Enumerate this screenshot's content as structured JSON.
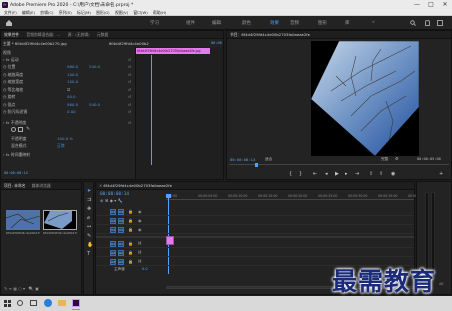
{
  "window": {
    "title": "Adobe Premiere Pro 2020 - C:\\用户\\文档\\未命名.prproj *",
    "menu": [
      "文件(F)",
      "编辑(E)",
      "剪辑(C)",
      "序列(S)",
      "标记(M)",
      "图形(G)",
      "视图(V)",
      "窗口(W)",
      "帮助(H)"
    ],
    "minimize": "—",
    "maximize": "□",
    "close": "✕"
  },
  "workspaces": [
    "学习",
    "组件",
    "编辑",
    "颜色",
    "效果",
    "音频",
    "图形",
    "库"
  ],
  "workspace_active": "效果",
  "effect_controls": {
    "tabs": [
      "效果控件",
      "音频剪辑混合器：...",
      "源：(无剪辑)",
      "元数据"
    ],
    "source_label": "主要 * 6f4d4f29fd4c4e00b270.jpg",
    "sequence_label": "6f4d4f29fd4c4e00b270 * 6f4d4f...",
    "timecode": "00:00",
    "clip_label": "6f4d4f29fd4c4e00b2703fa0aeae2fe.jpg",
    "section_video": "视频",
    "section_motion": "fx 运动",
    "rows": [
      {
        "name": "位置",
        "v1": "960.0",
        "v2": "540.0"
      },
      {
        "name": "缩放高度",
        "v1": "100.0",
        "v2": ""
      },
      {
        "name": "缩放宽度",
        "v1": "100.0",
        "v2": ""
      },
      {
        "name": "等比缩放",
        "v1": "",
        "v2": "",
        "check": true
      },
      {
        "name": "旋转",
        "v1": "40.0",
        "v2": ""
      },
      {
        "name": "锚点",
        "v1": "960.0",
        "v2": "540.0"
      },
      {
        "name": "防闪烁滤镜",
        "v1": "0.00",
        "v2": ""
      }
    ],
    "opacity_section": "fx 不透明度",
    "opacity_rows": [
      {
        "name": "不透明度",
        "v1": "100.0 %"
      },
      {
        "name": "混合模式",
        "v1": "正常"
      }
    ],
    "time_remap": "fx 时间重映射",
    "footer_timecode": "00:00:00:14"
  },
  "program_monitor": {
    "tab": "节目：6f4d4f29fd4c4e00b2703fa0aeae2fe",
    "timecode": "00:00:00:14",
    "fit": "适合",
    "quality": "完整",
    "duration": "00:00:05:00"
  },
  "project": {
    "tabs": [
      "项目: 未命名",
      "媒体浏览器"
    ],
    "items": [
      {
        "name": "6f4d4f29fd4c4e00b2703...",
        "duration": "5:00"
      },
      {
        "name": "6f4d4f29fd4c4e00b2703...",
        "duration": "5:00"
      }
    ]
  },
  "timeline": {
    "tab": "6f4d4f29fd4c4e00b2703fa0aeae2fe",
    "timecode": "00:00:00:14",
    "ruler": [
      "00:00",
      "00:00:05:00",
      "00:00:10:00",
      "00:00:15:00",
      "00:00:20:00",
      "00:00:25:00",
      "00:00:30:00",
      "00:00:35:00",
      "00:00:40:00"
    ],
    "tracks": [
      "V3",
      "V2",
      "V1",
      "A1",
      "A2",
      "A3"
    ],
    "master": "主声道",
    "master_value": "0.0",
    "audio_meter_label": "dB"
  },
  "watermark": "最需教育",
  "colors": {
    "accent": "#4da3ff",
    "clip": "#e47be7",
    "panel": "#232323",
    "background": "#1d1d1d"
  }
}
